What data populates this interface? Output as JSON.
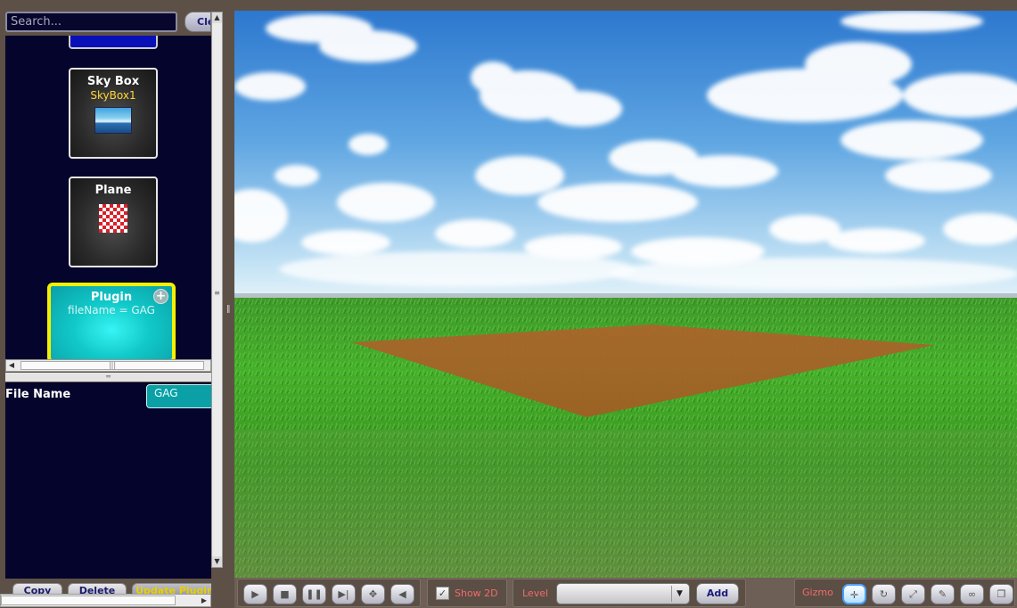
{
  "sidebar": {
    "search_placeholder": "Search...",
    "clear_label": "Clear",
    "tiles": [
      {
        "title": "Sky Box",
        "subtitle": "SkyBox1"
      },
      {
        "title": "Plane"
      },
      {
        "title": "Plugin",
        "subtitle": "fileName = GAG",
        "selected": true
      }
    ],
    "properties": {
      "label": "File Name",
      "value": "GAG"
    },
    "buttons": {
      "copy": "Copy",
      "delete": "Delete",
      "update_plugin": "Update Plugin"
    }
  },
  "toolbar": {
    "show2d_label": "Show 2D",
    "show2d_checked": true,
    "level_label": "Level",
    "level_value": "",
    "add_label": "Add",
    "gizmo_label": "Gizmo"
  },
  "icons": [
    "play-icon",
    "stop-icon",
    "pause-icon",
    "step-icon",
    "fullscreen-icon",
    "sound-icon",
    "move-icon",
    "rotate-icon",
    "scale-icon",
    "brush-icon",
    "link-icon",
    "copy-icon"
  ],
  "colors": {
    "panel_bg": "#05042c",
    "selected_tile_border": "#f5f000",
    "selected_tile_fill": "#11c8c8",
    "toolbar_label": "#f26b6b",
    "frame": "#5d5147"
  }
}
